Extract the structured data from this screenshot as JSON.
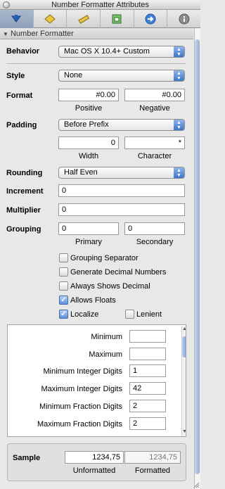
{
  "window": {
    "title": "Number Formatter Attributes"
  },
  "tabs": [
    {
      "icon": "attributes-icon"
    },
    {
      "icon": "effects-icon"
    },
    {
      "icon": "size-ruler-icon"
    },
    {
      "icon": "bindings-icon"
    },
    {
      "icon": "connections-arrow-icon"
    },
    {
      "icon": "info-icon"
    }
  ],
  "section": {
    "title": "Number Formatter"
  },
  "behavior": {
    "label": "Behavior",
    "value": "Mac OS X 10.4+ Custom"
  },
  "style": {
    "label": "Style",
    "value": "None"
  },
  "format": {
    "label": "Format",
    "positive": "#0.00",
    "negative": "#0.00",
    "positive_label": "Positive",
    "negative_label": "Negative"
  },
  "padding": {
    "label": "Padding",
    "value": "Before Prefix",
    "width": "0",
    "character": "*",
    "width_label": "Width",
    "character_label": "Character"
  },
  "rounding": {
    "label": "Rounding",
    "value": "Half Even"
  },
  "increment": {
    "label": "Increment",
    "value": "0"
  },
  "multiplier": {
    "label": "Multiplier",
    "value": "0"
  },
  "grouping": {
    "label": "Grouping",
    "primary": "0",
    "secondary": "0",
    "primary_label": "Primary",
    "secondary_label": "Secondary"
  },
  "checkboxes": {
    "grouping_separator": {
      "label": "Grouping Separator",
      "checked": false
    },
    "generate_decimal_numbers": {
      "label": "Generate Decimal Numbers",
      "checked": false
    },
    "always_shows_decimal": {
      "label": "Always Shows Decimal",
      "checked": false
    },
    "allows_floats": {
      "label": "Allows Floats",
      "checked": true
    },
    "localize": {
      "label": "Localize",
      "checked": true
    },
    "lenient": {
      "label": "Lenient",
      "checked": false
    }
  },
  "limits": {
    "rows": [
      {
        "label": "Minimum",
        "value": ""
      },
      {
        "label": "Maximum",
        "value": ""
      },
      {
        "label": "Minimum Integer Digits",
        "value": "1"
      },
      {
        "label": "Maximum Integer Digits",
        "value": "42"
      },
      {
        "label": "Minimum Fraction Digits",
        "value": "2"
      },
      {
        "label": "Maximum Fraction Digits",
        "value": "2"
      }
    ]
  },
  "sample": {
    "label": "Sample",
    "unformatted": "1234,75",
    "formatted": "1234,75",
    "unformatted_label": "Unformatted",
    "formatted_label": "Formatted"
  }
}
